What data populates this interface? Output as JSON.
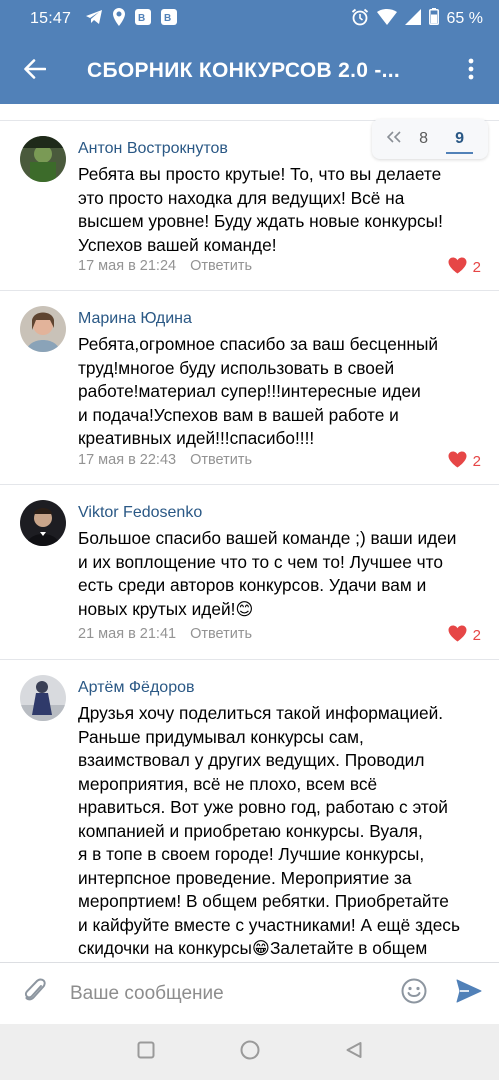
{
  "status_bar": {
    "time": "15:47",
    "battery_percent": "65 %",
    "icons": [
      "telegram-icon",
      "location-icon",
      "vk-notify-icon",
      "vk-notify-icon",
      "alarm-icon",
      "wifi-icon",
      "signal-icon",
      "battery-icon"
    ]
  },
  "header": {
    "title": "СБОРНИК КОНКУРСОВ 2.0 -...",
    "back_icon": "back-arrow-icon",
    "menu_icon": "more-vertical-icon"
  },
  "pagination": {
    "prev_icon": "double-chevron-left-icon",
    "pages": [
      "8",
      "9"
    ],
    "current": "9"
  },
  "comments": [
    {
      "author": "Антон Вострокнутов",
      "lines": [
        "Ребята вы просто крутые! То, что вы делаете",
        "это просто находка для ведущих! Всё на",
        "высшем уровне! Буду ждать новые конкурсы!",
        "Успехов вашей команде!"
      ],
      "date": "17 мая в 21:24",
      "reply": "Ответить",
      "likes": "2"
    },
    {
      "author": "Марина Юдина",
      "lines": [
        "Ребята,огромное спасибо за ваш бесценный",
        "труд!многое буду использовать в своей",
        "работе!материал супер!!!интересные идеи",
        "и подача!Успехов вам в вашей работе и",
        "креативных идей!!!спасибо!!!!"
      ],
      "date": "17 мая в 22:43",
      "reply": "Ответить",
      "likes": "2"
    },
    {
      "author": "Viktor Fedosenko",
      "lines": [
        "Большое спасибо вашей команде ;) ваши идеи",
        "и их воплощение что то с чем то! Лучшее что",
        "есть среди авторов конкурсов. Удачи вам и",
        "новых крутых идей!😊"
      ],
      "date": "21 мая в 21:41",
      "reply": "Ответить",
      "likes": "2"
    },
    {
      "author": "Артём Фёдоров",
      "lines": [
        "Друзья хочу поделиться такой информацией.",
        "Раньше придумывал конкурсы сам,",
        "взаимствовал у других ведущих. Проводил",
        "мероприятия, всё не плохо, всем всё",
        "нравиться. Вот уже ровно год, работаю с этой",
        "компанией и приобретаю конкурсы. Вуаля,",
        "я в топе в своем городе! Лучшие конкурсы,",
        "интерпсное проведение. Мероприятие за",
        "меропртием! В общем ребятки. Приобретайте",
        "и кайфуйте вместе с участниками! А ещё здесь",
        "скидочки на конкурсы😁Залетайте в общем"
      ],
      "date": "",
      "reply": "",
      "likes": ""
    }
  ],
  "composer": {
    "placeholder": "Ваше сообщение",
    "attach_icon": "paperclip-icon",
    "emoji_icon": "smiley-icon",
    "send_icon": "send-icon"
  },
  "nav": {
    "icons": [
      "recents-square-icon",
      "home-circle-icon",
      "back-triangle-icon"
    ]
  },
  "colors": {
    "header_bg": "#5181b8",
    "author": "#2a5885",
    "meta": "#939393",
    "like": "#e64646",
    "send": "#5181b8"
  }
}
